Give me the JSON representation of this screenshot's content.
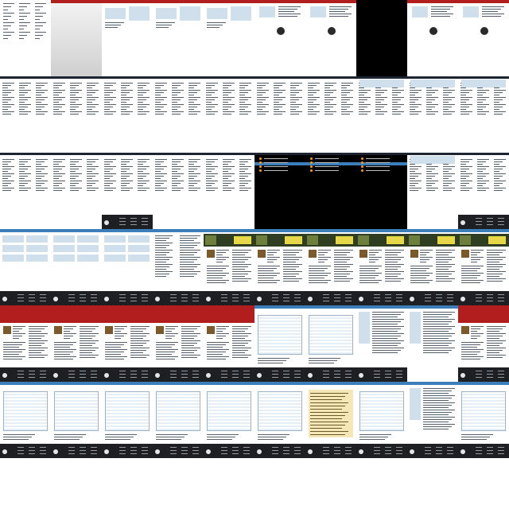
{
  "screen": {
    "description_note": "",
    "columns": 10,
    "rows": 6
  },
  "colors": {
    "header_red": "#b21d1d",
    "header_blue": "#3c7fb8",
    "panel_blue": "#cfe0ec",
    "footer_dark": "#1d1f22",
    "black_panel": "#000000",
    "hero_dark": "#2f3d20",
    "hero_text_yellow": "#e7d84a",
    "cream_panel": "#f6e7b6",
    "accent_orange": "#f0a020"
  },
  "tiles": [
    {
      "kind": "text-list",
      "footer": false,
      "header": "none"
    },
    {
      "kind": "gray-gradient",
      "footer": false,
      "header": "red"
    },
    {
      "kind": "page-blue-boxes",
      "footer": false,
      "header": "red"
    },
    {
      "kind": "page-blue-boxes",
      "footer": false,
      "header": "red"
    },
    {
      "kind": "page-blue-boxes",
      "footer": false,
      "header": "red"
    },
    {
      "kind": "page-logo",
      "footer": false,
      "header": "red"
    },
    {
      "kind": "page-logo",
      "footer": false,
      "header": "red"
    },
    {
      "kind": "black",
      "footer": false,
      "header": "none"
    },
    {
      "kind": "page-logo",
      "footer": false,
      "header": "red"
    },
    {
      "kind": "page-logo",
      "footer": false,
      "header": "red"
    },
    {
      "kind": "page-list",
      "footer": false,
      "header": "nav"
    },
    {
      "kind": "page-list",
      "footer": false,
      "header": "nav"
    },
    {
      "kind": "page-list",
      "footer": false,
      "header": "nav"
    },
    {
      "kind": "page-list",
      "footer": false,
      "header": "nav"
    },
    {
      "kind": "page-list",
      "footer": false,
      "header": "nav"
    },
    {
      "kind": "page-list",
      "footer": false,
      "header": "nav"
    },
    {
      "kind": "page-list",
      "footer": false,
      "header": "nav"
    },
    {
      "kind": "page-list-blue",
      "footer": false,
      "header": "nav"
    },
    {
      "kind": "page-list-blue",
      "footer": false,
      "header": "nav"
    },
    {
      "kind": "page-list-blue",
      "footer": false,
      "header": "nav"
    },
    {
      "kind": "page-list",
      "footer": false,
      "header": "nav"
    },
    {
      "kind": "page-list",
      "footer": false,
      "header": "nav"
    },
    {
      "kind": "page-list-footer",
      "footer": true,
      "header": "nav"
    },
    {
      "kind": "page-list",
      "footer": false,
      "header": "nav"
    },
    {
      "kind": "page-list",
      "footer": false,
      "header": "nav"
    },
    {
      "kind": "black-bullets",
      "footer": false,
      "header": "nav"
    },
    {
      "kind": "black-bullets",
      "footer": false,
      "header": "nav"
    },
    {
      "kind": "black-bullets",
      "footer": false,
      "header": "nav"
    },
    {
      "kind": "page-list-blue",
      "footer": false,
      "header": "nav"
    },
    {
      "kind": "page-list-footer",
      "footer": true,
      "header": "nav"
    },
    {
      "kind": "blue-panels-footer",
      "footer": true,
      "header": "blue"
    },
    {
      "kind": "blue-panels-footer",
      "footer": true,
      "header": "blue"
    },
    {
      "kind": "blue-panels-footer",
      "footer": true,
      "header": "blue"
    },
    {
      "kind": "site-home",
      "footer": true,
      "header": "blue"
    },
    {
      "kind": "site-home-hero",
      "footer": true,
      "header": "blue"
    },
    {
      "kind": "site-home-hero",
      "footer": true,
      "header": "blue"
    },
    {
      "kind": "site-home-hero",
      "footer": true,
      "header": "blue"
    },
    {
      "kind": "site-home-hero",
      "footer": true,
      "header": "blue"
    },
    {
      "kind": "site-home-hero",
      "footer": true,
      "header": "blue"
    },
    {
      "kind": "site-home-hero",
      "footer": true,
      "header": "blue"
    },
    {
      "kind": "site-red-banner",
      "footer": true,
      "header": "red"
    },
    {
      "kind": "site-red-banner",
      "footer": true,
      "header": "red"
    },
    {
      "kind": "site-red-banner",
      "footer": true,
      "header": "red"
    },
    {
      "kind": "site-red-banner",
      "footer": true,
      "header": "red"
    },
    {
      "kind": "site-red-banner",
      "footer": true,
      "header": "red"
    },
    {
      "kind": "site-table",
      "footer": true,
      "header": "blue"
    },
    {
      "kind": "site-table",
      "footer": true,
      "header": "blue"
    },
    {
      "kind": "site-text",
      "footer": true,
      "header": "blue"
    },
    {
      "kind": "site-text",
      "footer": false,
      "header": "blue"
    },
    {
      "kind": "site-red-banner",
      "footer": true,
      "header": "red"
    },
    {
      "kind": "site-table",
      "footer": true,
      "header": "blue"
    },
    {
      "kind": "site-table",
      "footer": true,
      "header": "blue"
    },
    {
      "kind": "site-table",
      "footer": true,
      "header": "blue"
    },
    {
      "kind": "site-table",
      "footer": true,
      "header": "blue"
    },
    {
      "kind": "site-table",
      "footer": true,
      "header": "blue"
    },
    {
      "kind": "site-table",
      "footer": true,
      "header": "blue"
    },
    {
      "kind": "site-cream",
      "footer": true,
      "header": "blue"
    },
    {
      "kind": "site-table",
      "footer": true,
      "header": "blue"
    },
    {
      "kind": "site-text",
      "footer": true,
      "header": "blue"
    },
    {
      "kind": "site-table",
      "footer": true,
      "header": "blue"
    }
  ]
}
